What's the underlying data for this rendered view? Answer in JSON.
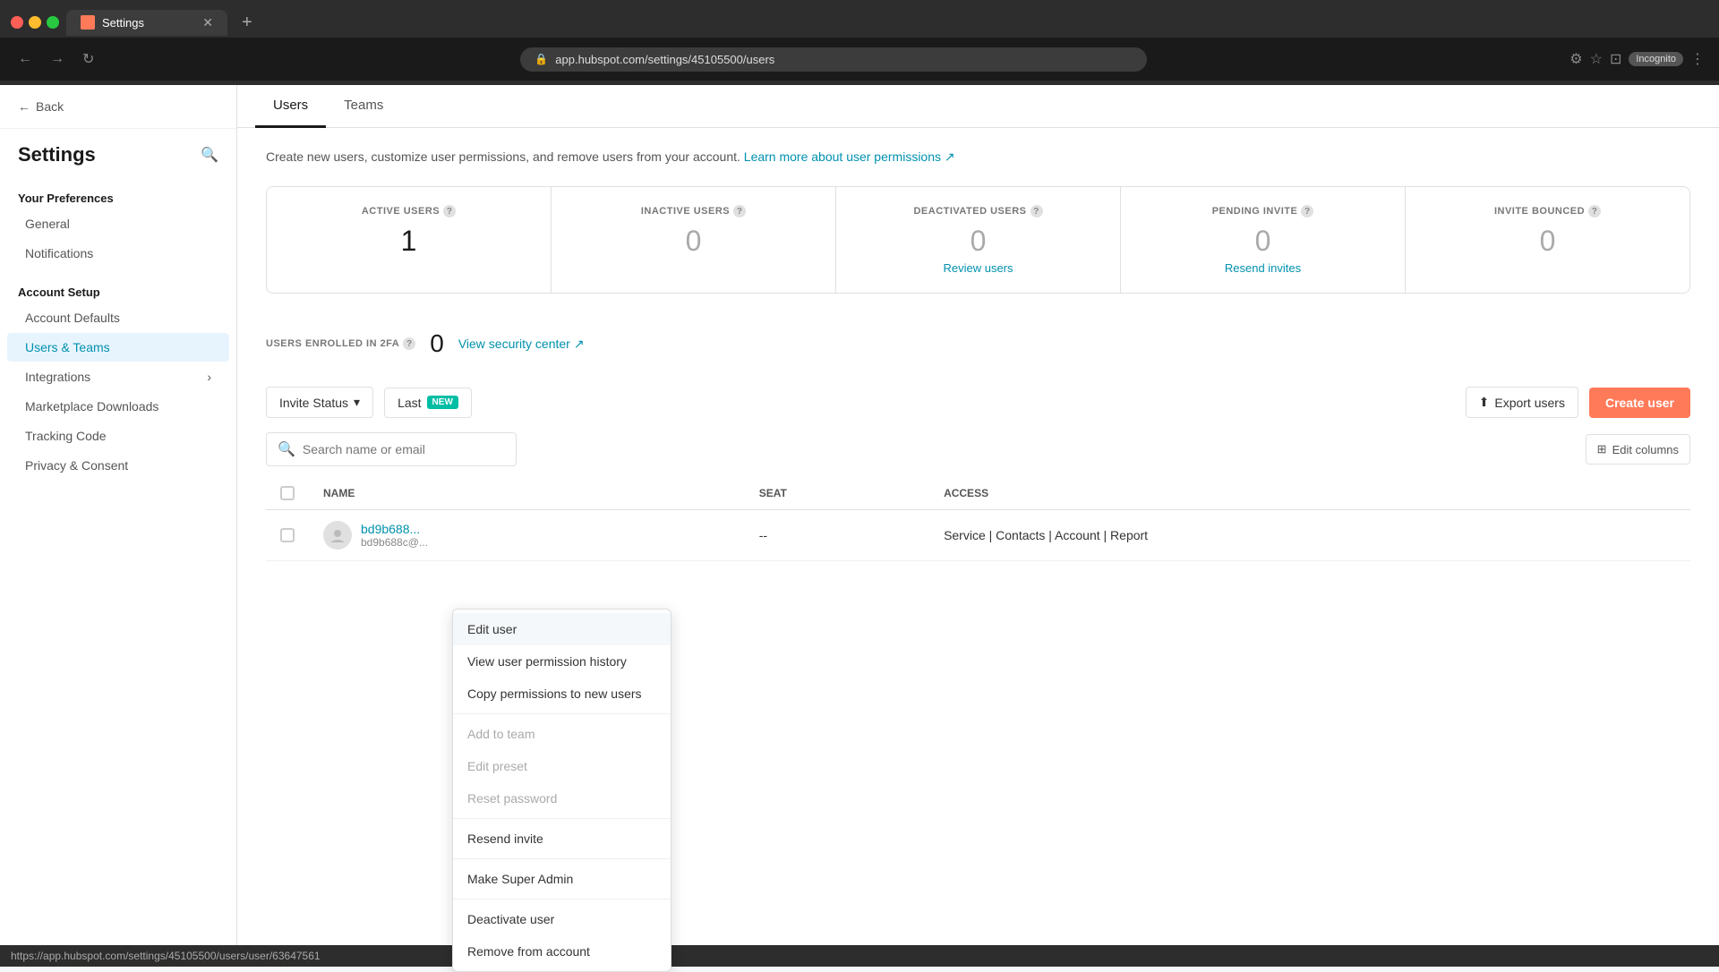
{
  "browser": {
    "tab_title": "Settings",
    "tab_favicon": "S",
    "url": "app.hubspot.com/settings/45105500/users",
    "new_tab_label": "+",
    "incognito_label": "Incognito"
  },
  "sidebar": {
    "back_label": "Back",
    "title": "Settings",
    "search_icon": "🔍",
    "sections": [
      {
        "label": "Your Preferences",
        "items": [
          {
            "id": "general",
            "label": "General",
            "active": false
          },
          {
            "id": "notifications",
            "label": "Notifications",
            "active": false
          }
        ]
      },
      {
        "label": "Account Setup",
        "items": [
          {
            "id": "account-defaults",
            "label": "Account Defaults",
            "active": false
          },
          {
            "id": "users-teams",
            "label": "Users & Teams",
            "active": true
          },
          {
            "id": "integrations",
            "label": "Integrations",
            "active": false,
            "arrow": true
          },
          {
            "id": "marketplace",
            "label": "Marketplace Downloads",
            "active": false
          },
          {
            "id": "tracking-code",
            "label": "Tracking Code",
            "active": false
          },
          {
            "id": "privacy-consent",
            "label": "Privacy & Consent",
            "active": false
          }
        ]
      }
    ]
  },
  "tabs": [
    {
      "id": "users",
      "label": "Users",
      "active": true
    },
    {
      "id": "teams",
      "label": "Teams",
      "active": false
    }
  ],
  "description": {
    "text": "Create new users, customize user permissions, and remove users from your account.",
    "link_text": "Learn more about user permissions",
    "link_icon": "↗"
  },
  "stats": [
    {
      "id": "active-users",
      "label": "ACTIVE USERS",
      "value": "1",
      "muted": false,
      "action": "",
      "action_type": "none"
    },
    {
      "id": "inactive-users",
      "label": "INACTIVE USERS",
      "value": "0",
      "muted": true,
      "action": "",
      "action_type": "none"
    },
    {
      "id": "deactivated-users",
      "label": "DEACTIVATED USERS",
      "value": "0",
      "muted": true,
      "action": "Review users",
      "action_type": "link"
    },
    {
      "id": "pending-invite",
      "label": "PENDING INVITE",
      "value": "0",
      "muted": true,
      "action": "Resend invites",
      "action_type": "link"
    },
    {
      "id": "invite-bounced",
      "label": "INVITE BOUNCED",
      "value": "0",
      "muted": true,
      "action": "",
      "action_type": "none"
    }
  ],
  "twofactor": {
    "label": "USERS ENROLLED IN 2FA",
    "value": "0",
    "link_text": "View security center",
    "link_icon": "↗"
  },
  "table_controls": {
    "invite_status_label": "Invite Status",
    "last_label": "Last",
    "new_badge": "NEW",
    "export_label": "Export users",
    "create_label": "Create user"
  },
  "search": {
    "placeholder": "Search name or email",
    "edit_columns_label": "Edit columns",
    "edit_columns_icon": "⊞"
  },
  "table": {
    "columns": [
      "NAME",
      "SEAT",
      "ACCESS"
    ],
    "rows": [
      {
        "id": "bd9b688",
        "name": "bd9b688...",
        "email": "bd9b688c@...",
        "seat": "--",
        "access": "Service | Contacts | Account | Report"
      }
    ]
  },
  "context_menu": {
    "items": [
      {
        "id": "edit-user",
        "label": "Edit user",
        "disabled": false,
        "highlighted": true
      },
      {
        "id": "view-permission-history",
        "label": "View user permission history",
        "disabled": false,
        "highlighted": false
      },
      {
        "id": "copy-permissions",
        "label": "Copy permissions to new users",
        "disabled": false,
        "highlighted": false
      },
      {
        "id": "add-to-team",
        "label": "Add to team",
        "disabled": true,
        "highlighted": false
      },
      {
        "id": "edit-preset",
        "label": "Edit preset",
        "disabled": true,
        "highlighted": false
      },
      {
        "id": "reset-password",
        "label": "Reset password",
        "disabled": true,
        "highlighted": false
      },
      {
        "id": "resend-invite",
        "label": "Resend invite",
        "disabled": false,
        "highlighted": false
      },
      {
        "id": "make-super-admin",
        "label": "Make Super Admin",
        "disabled": false,
        "highlighted": false
      },
      {
        "id": "deactivate-user",
        "label": "Deactivate user",
        "disabled": false,
        "highlighted": false
      },
      {
        "id": "remove-from-account",
        "label": "Remove from account",
        "disabled": false,
        "highlighted": false
      }
    ]
  },
  "statusbar": {
    "url": "https://app.hubspot.com/settings/45105500/users/user/63647561"
  }
}
